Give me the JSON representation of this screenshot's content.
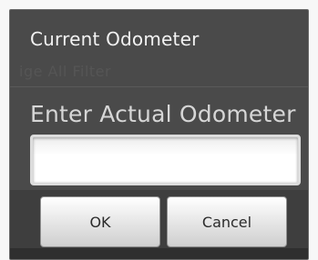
{
  "dialog": {
    "title": "Current Odometer",
    "background_hint": "ige All Filter",
    "prompt": "Enter Actual Odometer",
    "input_value": "",
    "ok_label": "OK",
    "cancel_label": "Cancel"
  },
  "colors": {
    "dialog_bg": "#4a4a4a",
    "title_text": "#f2f2f2",
    "prompt_text": "#d6d6d6",
    "button_text": "#2b2b2b"
  }
}
